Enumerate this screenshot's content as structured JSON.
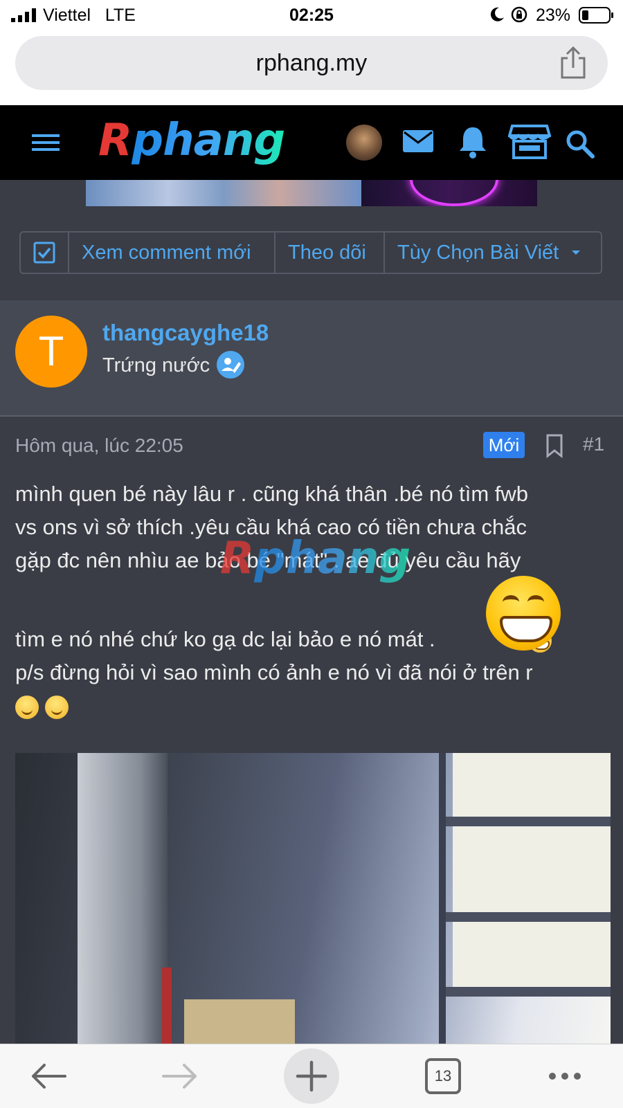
{
  "status_bar": {
    "carrier": "Viettel",
    "network": "LTE",
    "time": "02:25",
    "battery": "23%"
  },
  "browser": {
    "url": "rphang.my",
    "tab_count": "13"
  },
  "site": {
    "logo_text": "Rphang",
    "actions": {
      "new_comments": "Xem comment mới",
      "follow": "Theo dõi",
      "post_options": "Tùy Chọn Bài Viết"
    }
  },
  "author": {
    "avatar_letter": "T",
    "name": "thangcayghe18",
    "rank": "Trứng nước"
  },
  "post": {
    "timestamp": "Hôm qua, lúc 22:05",
    "new_badge": "Mới",
    "number": "#1",
    "lines": {
      "l1": "mình quen bé này lâu r . cũng khá thân .bé nó tìm fwb",
      "l2": "vs ons vì sở thích .yêu cầu khá cao có tiền chưa chắc",
      "l3": "gặp đc nên nhìu ae bảo bé \"mát\" . ae đủ yêu cầu hãy",
      "l4": "tìm e nó nhé chứ ko gạ dc lại bảo e nó mát .",
      "l4_tail": "D",
      "l5": "p/s đừng hỏi vì sao mình có ảnh e nó vì đã nói ở trên r"
    },
    "watermark": "Rphang"
  },
  "colors": {
    "page_bg": "#3a3d46",
    "header_bg": "#000000",
    "link_blue": "#4fa8f0",
    "badge_blue": "#2f80ed",
    "avatar_orange": "#ff9800"
  },
  "icons": {
    "header": [
      "menu-icon",
      "avatar",
      "mail-icon",
      "bell-icon",
      "store-icon",
      "search-icon"
    ],
    "toolbar": [
      "back-arrow-icon",
      "forward-arrow-icon",
      "plus-icon",
      "tabs-icon",
      "more-icon"
    ]
  }
}
